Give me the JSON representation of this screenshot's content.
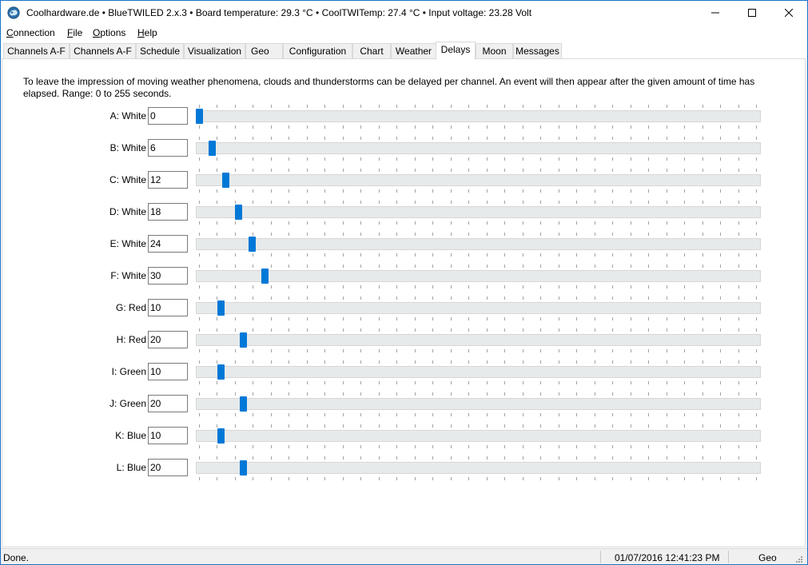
{
  "window": {
    "title": "Coolhardware.de • BlueTWILED 2.x.3 • Board temperature: 29.3 °C • CoolTWITemp: 27.4 °C • Input voltage: 23.28 Volt"
  },
  "menu": {
    "connection": {
      "pre": "",
      "key": "C",
      "rest": "onnection"
    },
    "file": {
      "pre": "",
      "key": "F",
      "rest": "ile"
    },
    "options": {
      "pre": "",
      "key": "O",
      "rest": "ptions"
    },
    "help": {
      "pre": "",
      "key": "H",
      "rest": "elp"
    }
  },
  "tabs": [
    {
      "label": "Channels A-F",
      "active": false
    },
    {
      "label": "Channels A-F",
      "active": false
    },
    {
      "label": "Schedule",
      "active": false
    },
    {
      "label": "Visualization",
      "active": false
    },
    {
      "label": "Geo",
      "active": false
    },
    {
      "label": "Configuration",
      "active": false
    },
    {
      "label": "Chart",
      "active": false
    },
    {
      "label": "Weather",
      "active": false
    },
    {
      "label": "Delays",
      "active": true
    },
    {
      "label": "Moon",
      "active": false
    },
    {
      "label": "Messages",
      "active": false
    }
  ],
  "description": "To leave the impression of moving weather phenomena, clouds and thunderstorms can be delayed per channel. An event will then appear after the given amount of time has elapsed. Range: 0 to 255 seconds.",
  "slider_range": {
    "min": 0,
    "max": 255
  },
  "delays": [
    {
      "label": "A: White",
      "value": "0"
    },
    {
      "label": "B: White",
      "value": "6"
    },
    {
      "label": "C: White",
      "value": "12"
    },
    {
      "label": "D: White",
      "value": "18"
    },
    {
      "label": "E: White",
      "value": "24"
    },
    {
      "label": "F: White",
      "value": "30"
    },
    {
      "label": "G: Red",
      "value": "10"
    },
    {
      "label": "H: Red",
      "value": "20"
    },
    {
      "label": "I: Green",
      "value": "10"
    },
    {
      "label": "J: Green",
      "value": "20"
    },
    {
      "label": "K: Blue",
      "value": "10"
    },
    {
      "label": "L: Blue",
      "value": "20"
    }
  ],
  "status": {
    "message": "Done.",
    "datetime": "01/07/2016 12:41:23 PM",
    "location": "Geo"
  },
  "colors": {
    "accent": "#0078d7",
    "window_border": "#1a73c8"
  }
}
